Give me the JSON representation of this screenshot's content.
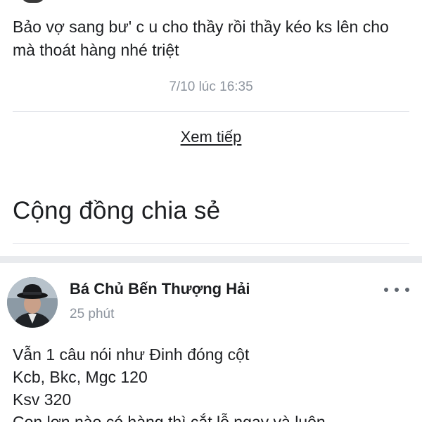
{
  "comment": {
    "text": "Bảo vợ sang bư' c u cho thầy rồi thầy kéo ks lên cho mà thoát hàng nhé triệt",
    "timestamp": "7/10 lúc 16:35"
  },
  "see_more_label": "Xem tiếp",
  "section": {
    "title": "Cộng đồng chia sẻ"
  },
  "post": {
    "author": "Bá Chủ Bến Thượng Hải",
    "time": "25 phút",
    "more_icon": "more-horizontal-icon",
    "lines": [
      "Vẫn 1 câu nói như Đinh đóng cột",
      "Kcb, Bkc, Mgc 120",
      "Ksv 320",
      "Con lợn nào có hàng thì cắt lỗ ngay và luôn"
    ]
  },
  "colors": {
    "text": "#1c1e21",
    "muted": "#8d949e",
    "divider": "#e4e6eb",
    "gap": "#e9ebee"
  }
}
